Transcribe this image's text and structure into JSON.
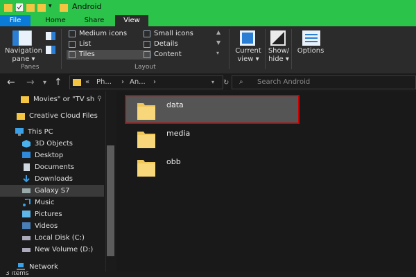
{
  "window": {
    "title": "Android"
  },
  "tabs": [
    {
      "label": "File"
    },
    {
      "label": "Home"
    },
    {
      "label": "Share"
    },
    {
      "label": "View"
    }
  ],
  "ribbon": {
    "panes": {
      "navigation_pane_label": "Navigation\npane ▾",
      "group_label": "Panes"
    },
    "layout": {
      "group_label": "Layout",
      "items": [
        "Medium icons",
        "List",
        "Tiles",
        "Small icons",
        "Details",
        "Content"
      ],
      "selected": "Tiles"
    },
    "current_view": "Current\nview ▾",
    "show_hide": "Show/\nhide ▾",
    "options": "Options"
  },
  "address": {
    "path_parts": [
      "«",
      "Ph...",
      "›",
      "An...",
      "›"
    ],
    "search_placeholder": "Search Android"
  },
  "sidebar": {
    "items": [
      {
        "label": "Movies\" or \"TV sh",
        "icon": "folder-icon"
      },
      {
        "label": "Creative Cloud Files",
        "icon": "cloud-folder-icon"
      },
      {
        "label": "This PC",
        "icon": "computer-icon"
      },
      {
        "label": "3D Objects",
        "icon": "cube-icon"
      },
      {
        "label": "Desktop",
        "icon": "desktop-icon"
      },
      {
        "label": "Documents",
        "icon": "documents-icon"
      },
      {
        "label": "Downloads",
        "icon": "download-icon"
      },
      {
        "label": "Galaxy S7",
        "icon": "phone-icon"
      },
      {
        "label": "Music",
        "icon": "music-icon"
      },
      {
        "label": "Pictures",
        "icon": "pictures-icon"
      },
      {
        "label": "Videos",
        "icon": "videos-icon"
      },
      {
        "label": "Local Disk (C:)",
        "icon": "drive-icon"
      },
      {
        "label": "New Volume (D:)",
        "icon": "drive-icon"
      },
      {
        "label": "Network",
        "icon": "network-icon"
      }
    ]
  },
  "folders": [
    {
      "name": "data"
    },
    {
      "name": "media"
    },
    {
      "name": "obb"
    }
  ],
  "status": {
    "count": "3 items"
  },
  "colors": {
    "titlebar": "#2bc34a",
    "file_tab": "#0a7bd6",
    "selection_outline": "#cc0000",
    "folder": "#f0c85a"
  }
}
